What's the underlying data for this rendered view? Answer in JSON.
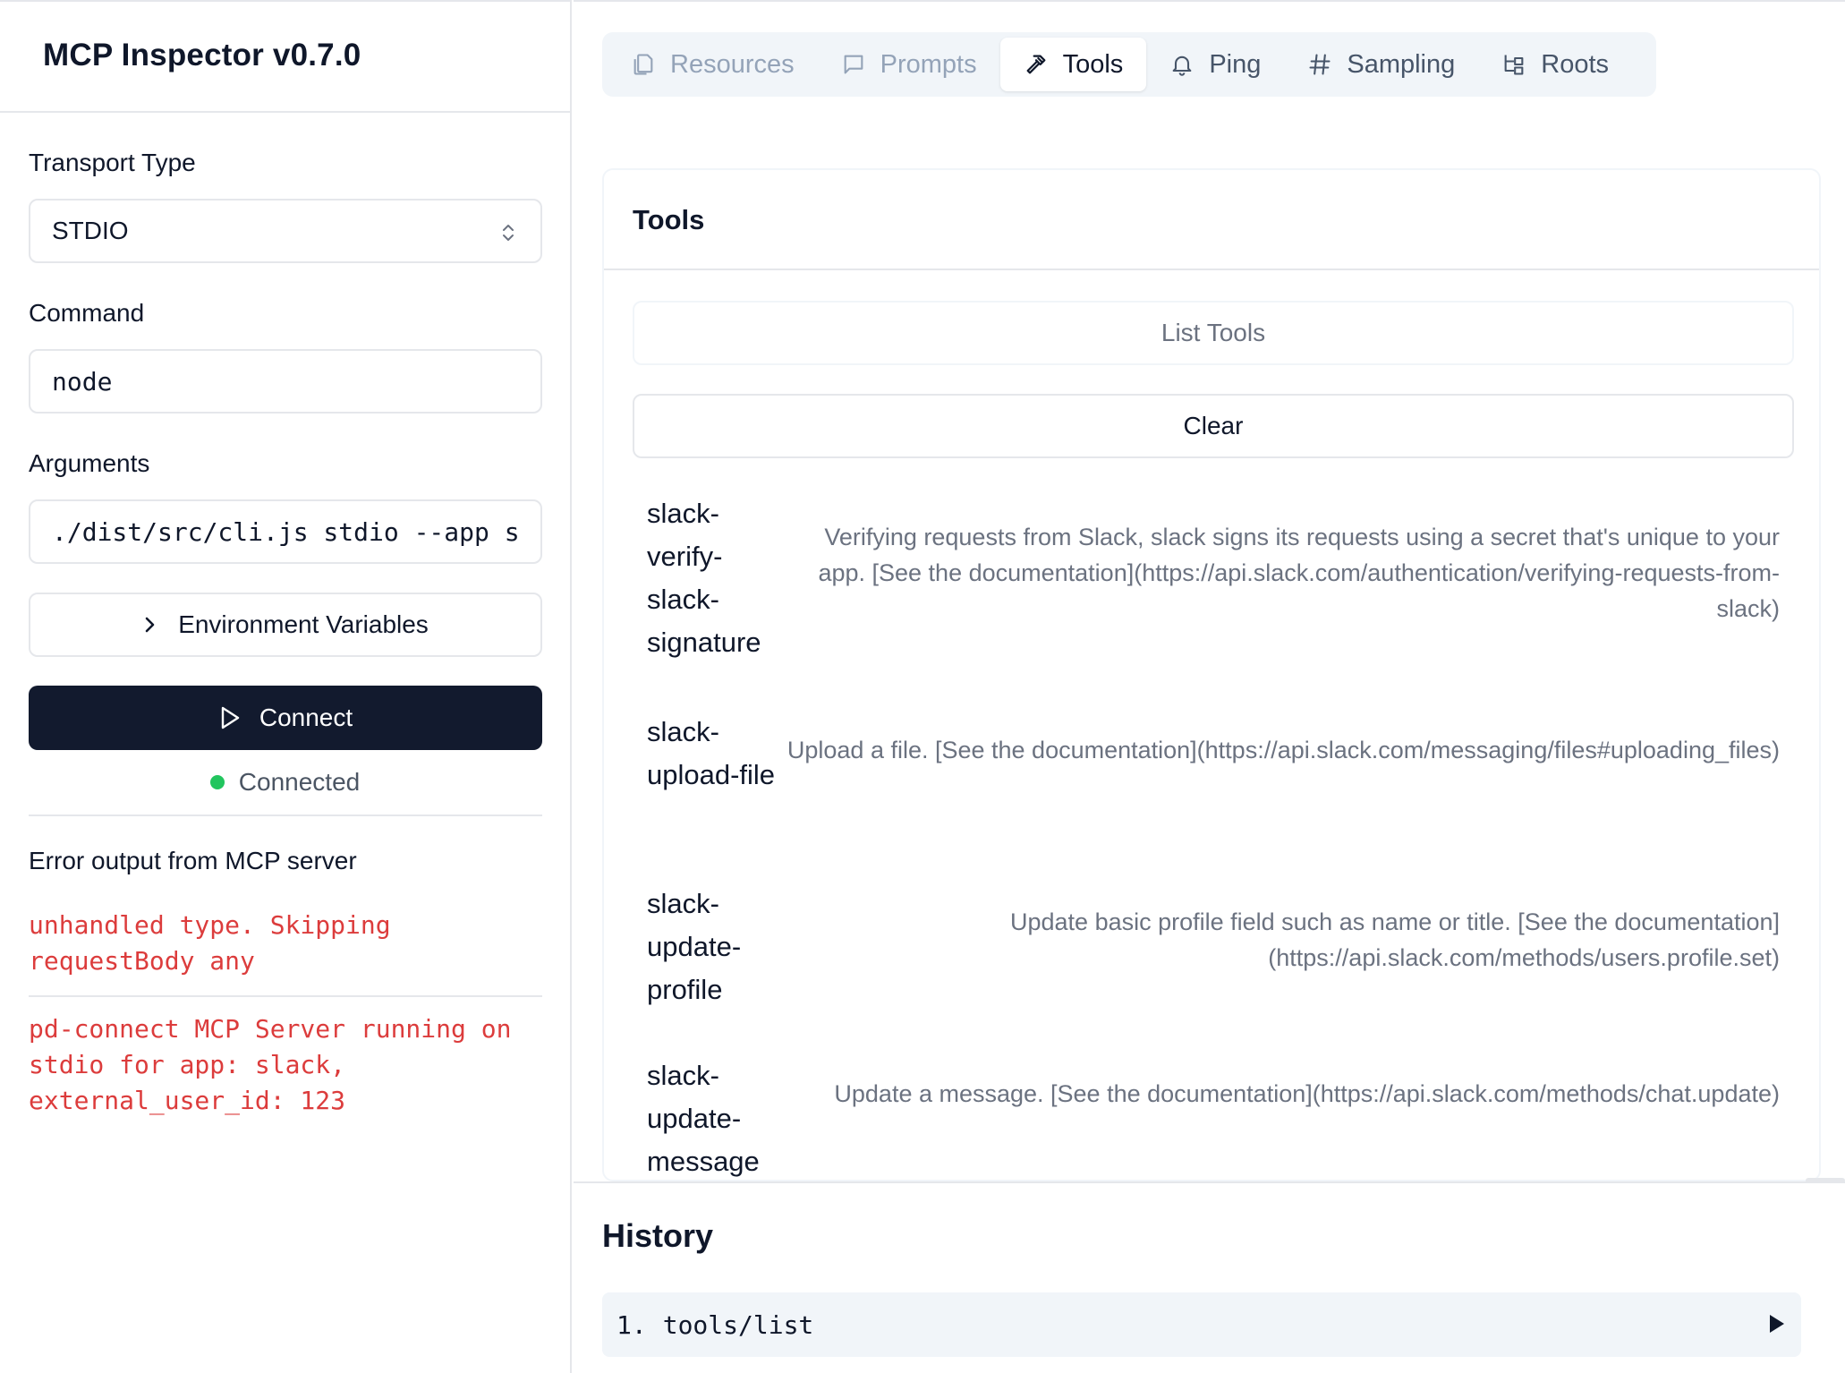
{
  "app": {
    "title": "MCP Inspector v0.7.0"
  },
  "sidebar": {
    "transport": {
      "label": "Transport Type",
      "value": "STDIO"
    },
    "command": {
      "label": "Command",
      "value": "node"
    },
    "arguments": {
      "label": "Arguments",
      "value": "./dist/src/cli.js stdio --app s"
    },
    "env_button": "Environment Variables",
    "connect_button": "Connect",
    "status": {
      "text": "Connected",
      "color": "#22c55e"
    },
    "error_title": "Error output from MCP server",
    "errors": [
      "unhandled type. Skipping\nrequestBody any",
      "pd-connect MCP Server running on\nstdio for app: slack,\nexternal_user_id: 123"
    ]
  },
  "tabs": [
    {
      "label": "Resources",
      "icon": "files-icon",
      "state": "disabled"
    },
    {
      "label": "Prompts",
      "icon": "message-square-icon",
      "state": "disabled"
    },
    {
      "label": "Tools",
      "icon": "hammer-icon",
      "state": "active"
    },
    {
      "label": "Ping",
      "icon": "bell-icon",
      "state": "enabled"
    },
    {
      "label": "Sampling",
      "icon": "hash-icon",
      "state": "enabled"
    },
    {
      "label": "Roots",
      "icon": "folder-tree-icon",
      "state": "enabled"
    }
  ],
  "tools_panel": {
    "title": "Tools",
    "list_button": "List Tools",
    "clear_button": "Clear",
    "tools": [
      {
        "name": "slack-verify-slack-signature",
        "description": "Verifying requests from Slack, slack signs its requests using a secret that's unique to your app. [See the documentation](https://api.slack.com/authentication/verifying-requests-from-slack)"
      },
      {
        "name": "slack-upload-file",
        "description": "Upload a file. [See the documentation](https://api.slack.com/messaging/files#uploading_files)"
      },
      {
        "name": "slack-update-profile",
        "description": "Update basic profile field such as name or title. [See the documentation](https://api.slack.com/methods/users.profile.set)"
      },
      {
        "name": "slack-update-message",
        "description": "Update a message. [See the documentation](https://api.slack.com/methods/chat.update)"
      }
    ]
  },
  "history": {
    "title": "History",
    "items": [
      {
        "index": "1.",
        "method": "tools/list"
      }
    ]
  }
}
